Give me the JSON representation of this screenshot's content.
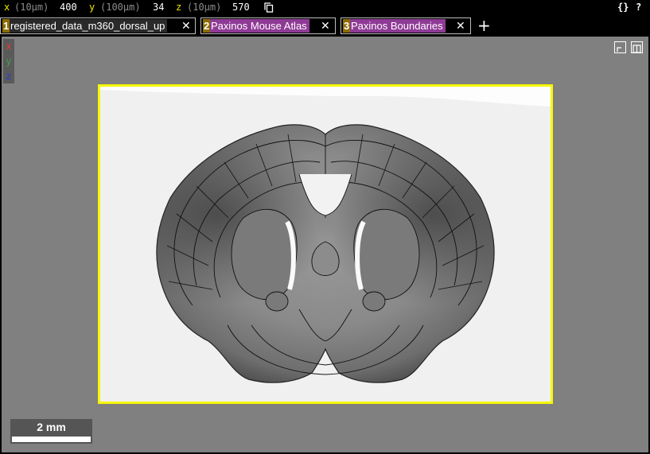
{
  "position": {
    "x": {
      "axis": "x",
      "unit": "(10µm)",
      "value": "400"
    },
    "y": {
      "axis": "y",
      "unit": "(100µm)",
      "value": "34"
    },
    "z": {
      "axis": "z",
      "unit": "(10µm)",
      "value": "570"
    }
  },
  "toolbar": {
    "json_label": "{}",
    "help_label": "?"
  },
  "layers": [
    {
      "number": "1",
      "name": "registered_data_m360_dorsal_up",
      "close": "✕",
      "color": "#8b6d00",
      "name_bg": "#2a2a2a"
    },
    {
      "number": "2",
      "name": "Paxinos Mouse Atlas",
      "close": "✕",
      "color": "#8b6d00",
      "name_bg": "#8f3a96"
    },
    {
      "number": "3",
      "name": "Paxinos Boundaries",
      "close": "✕",
      "color": "#8b6d00",
      "name_bg": "#8f3a96"
    }
  ],
  "add_layer_label": "+",
  "axes_legend": {
    "x": "x",
    "y": "y",
    "z": "z"
  },
  "scale_bar": {
    "label": "2 mm"
  },
  "colors": {
    "selection_border": "#f7f700",
    "panel_bg": "#808080"
  }
}
